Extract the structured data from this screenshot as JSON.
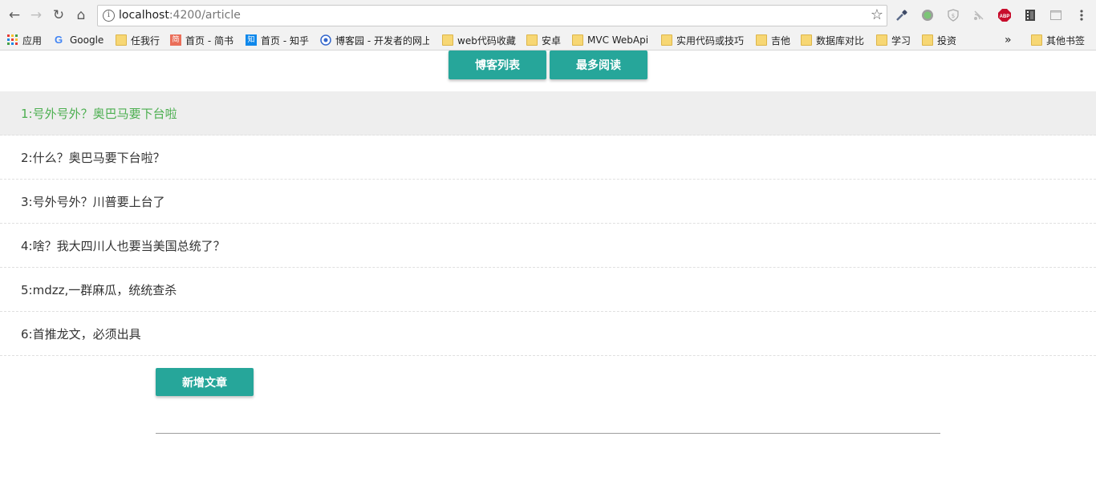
{
  "browser": {
    "url_host": "localhost",
    "url_rest": ":4200/article",
    "bookmarks": [
      {
        "label": "应用",
        "icon": "apps-grid-icon"
      },
      {
        "label": "Google",
        "icon": "google-icon"
      },
      {
        "label": "任我行",
        "icon": "folder-icon"
      },
      {
        "label": "首页 - 简书",
        "icon": "jianshu-icon"
      },
      {
        "label": "首页 - 知乎",
        "icon": "zhihu-icon"
      },
      {
        "label": "博客园 - 开发者的网上",
        "icon": "cnblogs-icon"
      },
      {
        "label": "web代码收藏",
        "icon": "folder-icon"
      },
      {
        "label": "安卓",
        "icon": "folder-icon"
      },
      {
        "label": "MVC WebApi",
        "icon": "folder-icon"
      },
      {
        "label": "实用代码或技巧",
        "icon": "folder-icon"
      },
      {
        "label": "吉他",
        "icon": "folder-icon"
      },
      {
        "label": "数据库对比",
        "icon": "folder-icon"
      },
      {
        "label": "学习",
        "icon": "folder-icon"
      },
      {
        "label": "投资",
        "icon": "folder-icon"
      }
    ],
    "overflow": "»",
    "other_bookmarks": "其他书签",
    "jianshu_glyph": "简",
    "zhihu_glyph": "知",
    "abp_label": "ABP"
  },
  "nav": {
    "blog_list_label": "博客列表",
    "most_read_label": "最多阅读"
  },
  "articles": [
    "1:号外号外？奥巴马要下台啦",
    "2:什么？奥巴马要下台啦？",
    "3:号外号外？川普要上台了",
    "4:啥？我大四川人也要当美国总统了？",
    "5:mdzz,一群麻瓜，统统查杀",
    "6:首推龙文，必须出具"
  ],
  "add_article_label": "新增文章",
  "colors": {
    "accent": "#26a69a",
    "active_text": "#4caf50",
    "active_bg": "#eeeeee"
  }
}
